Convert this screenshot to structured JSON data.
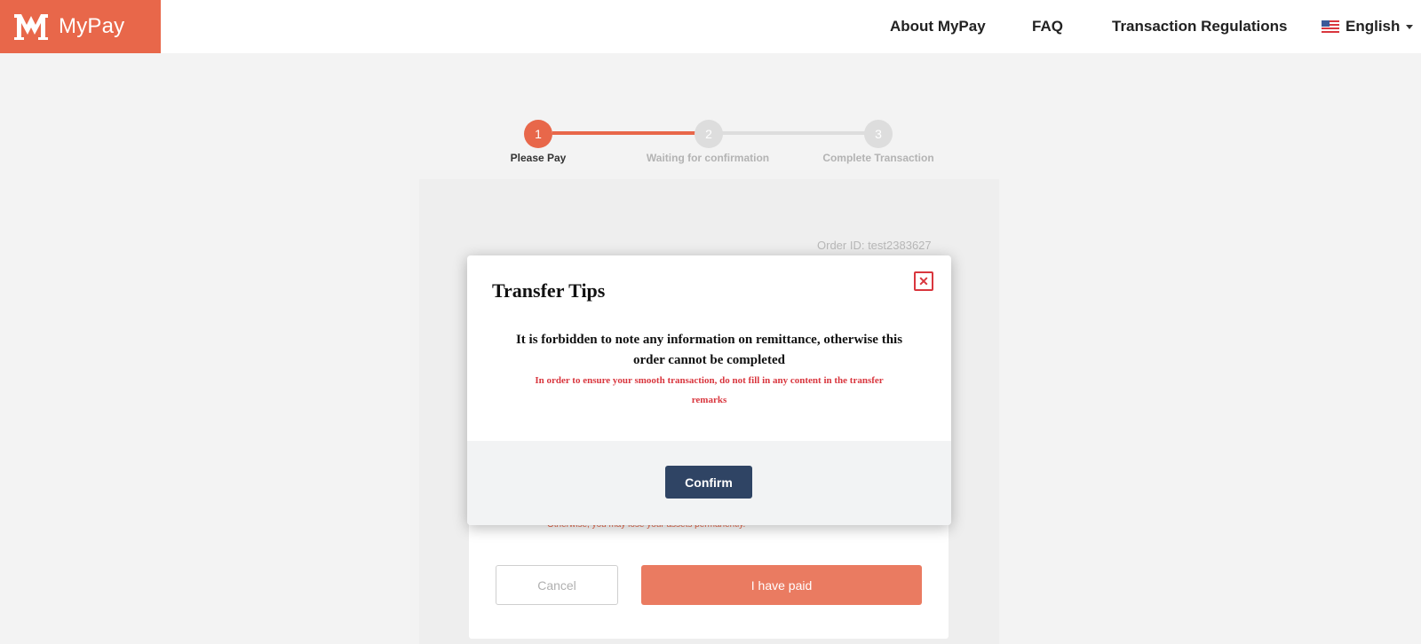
{
  "header": {
    "logo_text": "MyPay",
    "nav": {
      "about": "About MyPay",
      "faq": "FAQ",
      "regulations": "Transaction Regulations",
      "language": "English"
    },
    "brand_color": "#e8674a"
  },
  "stepper": {
    "current_step": 1,
    "steps": [
      {
        "number": "1",
        "label": "Please Pay"
      },
      {
        "number": "2",
        "label": "Waiting for confirmation"
      },
      {
        "number": "3",
        "label": "Complete Transaction"
      }
    ]
  },
  "order": {
    "order_id": "Order ID: test2383627",
    "warning": "Otherwise, you may lose your assets permanently.",
    "cancel_label": "Cancel",
    "paid_label": "I have paid"
  },
  "modal": {
    "title": "Transfer Tips",
    "close_icon": "close-icon",
    "message": "It is forbidden to note any information on remittance, otherwise this order cannot be completed",
    "sub_message": "In order to ensure your smooth transaction, do not fill in any content in the transfer remarks",
    "confirm_label": "Confirm",
    "confirm_color": "#2f4464",
    "warning_color": "#d9363e"
  }
}
